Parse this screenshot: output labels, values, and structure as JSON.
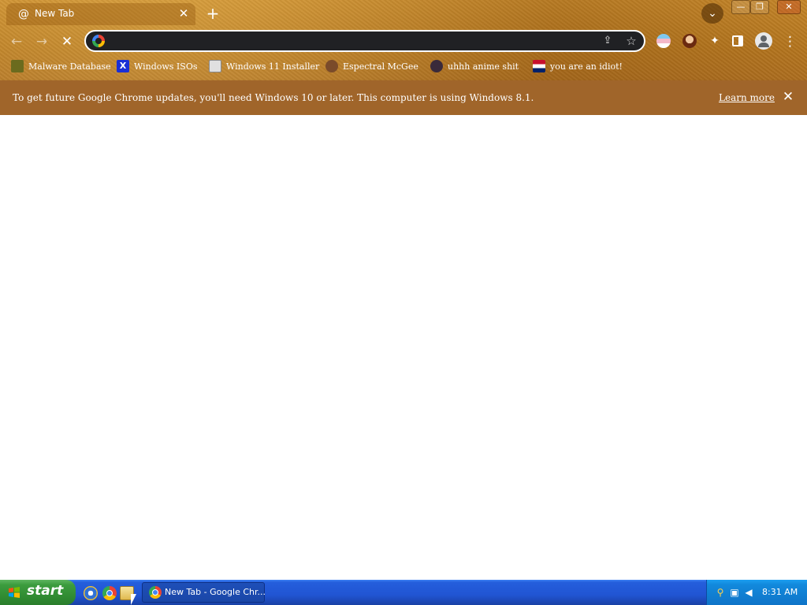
{
  "browser": {
    "tab": {
      "title": "New Tab",
      "favicon": "spiral-icon",
      "close_glyph": "✕"
    },
    "new_tab_glyph": "+",
    "tab_search_glyph": "⌄",
    "window_controls": {
      "minimize": "—",
      "maximize": "❐",
      "close": "✕"
    },
    "toolbar": {
      "back_glyph": "←",
      "forward_glyph": "→",
      "stop_glyph": "✕",
      "omnibox": {
        "value": "",
        "placeholder": ""
      },
      "share_glyph": "⇪",
      "star_glyph": "☆",
      "extensions_glyph": "✦",
      "menu_glyph": "⋮"
    },
    "bookmarks": [
      {
        "label": "Malware Database",
        "icon": "folder-icon",
        "icon_color": "#6b6b1e"
      },
      {
        "label": "Windows ISOs",
        "icon": "x-logo-icon",
        "icon_color": "#1a2fd6"
      },
      {
        "label": "Windows 11 Installer",
        "icon": "installer-icon",
        "icon_color": "#e0e0e0"
      },
      {
        "label": "Espectral McGee",
        "icon": "avatar-icon",
        "icon_color": "#7a4b2a"
      },
      {
        "label": "uhhh anime shit",
        "icon": "anime-face-icon",
        "icon_color": "#3a2a3a"
      },
      {
        "label": "you are an idiot!",
        "icon": "flag-icon",
        "icon_color": "#c8102e"
      }
    ],
    "infobar": {
      "message": "To get future Google Chrome updates, you'll need Windows 10 or later. This computer is using Windows 8.1.",
      "link": "Learn more",
      "close_glyph": "✕"
    }
  },
  "taskbar": {
    "start_label": "start",
    "task_button": "New Tab - Google Chr...",
    "clock": "8:31 AM"
  },
  "colors": {
    "theme": "#b8781f",
    "infobar": "#a0652a",
    "taskbar": "#245edc",
    "start": "#3c9c3e"
  }
}
